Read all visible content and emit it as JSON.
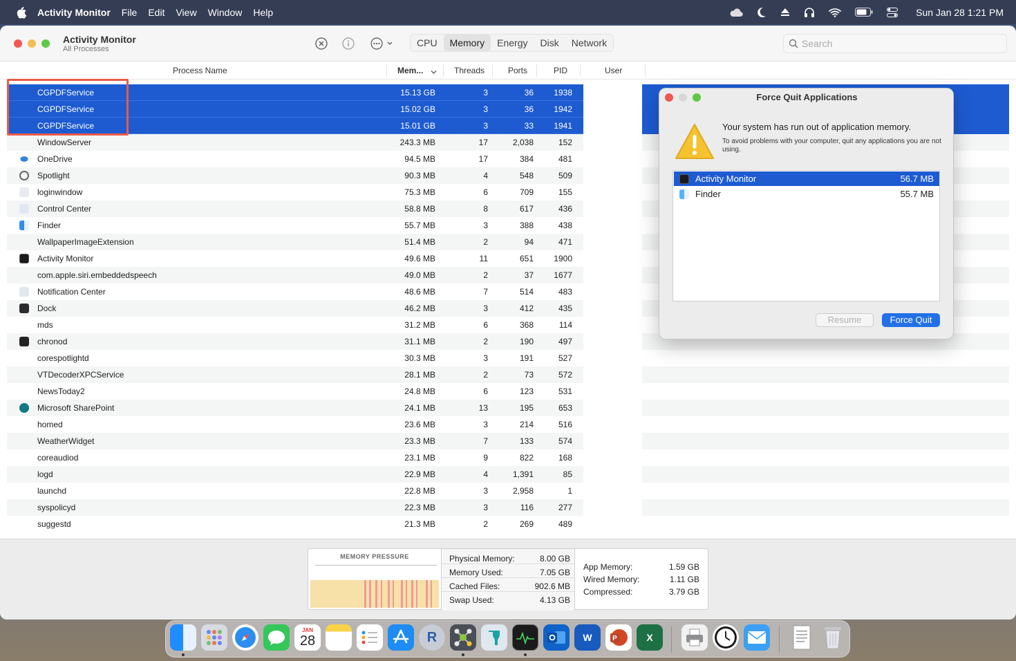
{
  "menubar": {
    "app_name": "Activity Monitor",
    "items": [
      "File",
      "Edit",
      "View",
      "Window",
      "Help"
    ],
    "clock": "Sun Jan 28  1:21 PM",
    "status_icons": [
      "icloud-icon",
      "moon-icon",
      "eject-icon",
      "headphones-icon",
      "wifi-icon",
      "battery-icon",
      "control-center-icon"
    ]
  },
  "window": {
    "title": "Activity Monitor",
    "subtitle": "All Processes",
    "tabs": [
      "CPU",
      "Memory",
      "Energy",
      "Disk",
      "Network"
    ],
    "active_tab": "Memory",
    "search_placeholder": "Search"
  },
  "table": {
    "columns": {
      "name": "Process Name",
      "mem": "Mem...",
      "threads": "Threads",
      "ports": "Ports",
      "pid": "PID",
      "user": "User"
    },
    "rows": [
      {
        "name": "CGPDFService",
        "mem": "15.13 GB",
        "threads": "3",
        "ports": "36",
        "pid": "1938",
        "icon": "none",
        "selected": true
      },
      {
        "name": "CGPDFService",
        "mem": "15.02 GB",
        "threads": "3",
        "ports": "36",
        "pid": "1942",
        "icon": "none",
        "selected": true
      },
      {
        "name": "CGPDFService",
        "mem": "15.01 GB",
        "threads": "3",
        "ports": "33",
        "pid": "1941",
        "icon": "none",
        "selected": true
      },
      {
        "name": "WindowServer",
        "mem": "243.3 MB",
        "threads": "17",
        "ports": "2,038",
        "pid": "152",
        "icon": "none"
      },
      {
        "name": "OneDrive",
        "mem": "94.5 MB",
        "threads": "17",
        "ports": "384",
        "pid": "481",
        "icon": "onedrive-icon"
      },
      {
        "name": "Spotlight",
        "mem": "90.3 MB",
        "threads": "4",
        "ports": "548",
        "pid": "509",
        "icon": "spotlight-icon"
      },
      {
        "name": "loginwindow",
        "mem": "75.3 MB",
        "threads": "6",
        "ports": "709",
        "pid": "155",
        "icon": "loginwindow-icon"
      },
      {
        "name": "Control Center",
        "mem": "58.8 MB",
        "threads": "8",
        "ports": "617",
        "pid": "436",
        "icon": "control-center-icon"
      },
      {
        "name": "Finder",
        "mem": "55.7 MB",
        "threads": "3",
        "ports": "388",
        "pid": "438",
        "icon": "finder-icon"
      },
      {
        "name": "WallpaperImageExtension",
        "mem": "51.4 MB",
        "threads": "2",
        "ports": "94",
        "pid": "471",
        "icon": "none"
      },
      {
        "name": "Activity Monitor",
        "mem": "49.6 MB",
        "threads": "11",
        "ports": "651",
        "pid": "1900",
        "icon": "activity-monitor-icon"
      },
      {
        "name": "com.apple.siri.embeddedspeech",
        "mem": "49.0 MB",
        "threads": "2",
        "ports": "37",
        "pid": "1677",
        "icon": "none"
      },
      {
        "name": "Notification Center",
        "mem": "48.6 MB",
        "threads": "7",
        "ports": "514",
        "pid": "483",
        "icon": "notification-center-icon"
      },
      {
        "name": "Dock",
        "mem": "46.2 MB",
        "threads": "3",
        "ports": "412",
        "pid": "435",
        "icon": "dock-icon"
      },
      {
        "name": "mds",
        "mem": "31.2 MB",
        "threads": "6",
        "ports": "368",
        "pid": "114",
        "icon": "none"
      },
      {
        "name": "chronod",
        "mem": "31.1 MB",
        "threads": "2",
        "ports": "190",
        "pid": "497",
        "icon": "chronod-icon"
      },
      {
        "name": "corespotlightd",
        "mem": "30.3 MB",
        "threads": "3",
        "ports": "191",
        "pid": "527",
        "icon": "none"
      },
      {
        "name": "VTDecoderXPCService",
        "mem": "28.1 MB",
        "threads": "2",
        "ports": "73",
        "pid": "572",
        "icon": "none"
      },
      {
        "name": "NewsToday2",
        "mem": "24.8 MB",
        "threads": "6",
        "ports": "123",
        "pid": "531",
        "icon": "none"
      },
      {
        "name": "Microsoft SharePoint",
        "mem": "24.1 MB",
        "threads": "13",
        "ports": "195",
        "pid": "653",
        "icon": "sharepoint-icon"
      },
      {
        "name": "homed",
        "mem": "23.6 MB",
        "threads": "3",
        "ports": "214",
        "pid": "516",
        "icon": "none"
      },
      {
        "name": "WeatherWidget",
        "mem": "23.3 MB",
        "threads": "7",
        "ports": "133",
        "pid": "574",
        "icon": "none"
      },
      {
        "name": "coreaudiod",
        "mem": "23.1 MB",
        "threads": "9",
        "ports": "822",
        "pid": "168",
        "icon": "none"
      },
      {
        "name": "logd",
        "mem": "22.9 MB",
        "threads": "4",
        "ports": "1,391",
        "pid": "85",
        "icon": "none"
      },
      {
        "name": "launchd",
        "mem": "22.8 MB",
        "threads": "3",
        "ports": "2,958",
        "pid": "1",
        "icon": "none"
      },
      {
        "name": "syspolicyd",
        "mem": "22.3 MB",
        "threads": "3",
        "ports": "116",
        "pid": "277",
        "icon": "none"
      },
      {
        "name": "suggestd",
        "mem": "21.3 MB",
        "threads": "2",
        "ports": "269",
        "pid": "489",
        "icon": "none"
      }
    ]
  },
  "memory_pressure": {
    "title": "MEMORY PRESSURE",
    "colors": {
      "normal": "#f7e1a8",
      "critical": "#ef9a9a"
    },
    "stats_mid": [
      {
        "label": "Physical Memory:",
        "value": "8.00 GB"
      },
      {
        "label": "Memory Used:",
        "value": "7.05 GB"
      },
      {
        "label": "Cached Files:",
        "value": "902.6 MB"
      },
      {
        "label": "Swap Used:",
        "value": "4.13 GB"
      }
    ],
    "stats_right": [
      {
        "label": "App Memory:",
        "value": "1.59 GB"
      },
      {
        "label": "Wired Memory:",
        "value": "1.11 GB"
      },
      {
        "label": "Compressed:",
        "value": "3.79 GB"
      }
    ]
  },
  "dialog": {
    "title": "Force Quit Applications",
    "message": "Your system has run out of application memory.",
    "submessage": "To avoid problems with your computer, quit any applications you are not using.",
    "apps": [
      {
        "name": "Activity Monitor",
        "mem": "56.7 MB",
        "icon": "activity-monitor-icon",
        "selected": true
      },
      {
        "name": "Finder",
        "mem": "55.7 MB",
        "icon": "finder-icon",
        "selected": false
      }
    ],
    "resume_label": "Resume",
    "force_quit_label": "Force Quit"
  },
  "dock": {
    "calendar_month": "JAN",
    "calendar_day": "28",
    "r_label": "R",
    "items": [
      "finder-icon",
      "launchpad-icon",
      "safari-icon",
      "messages-icon",
      "calendar-icon",
      "notes-icon",
      "reminders-icon",
      "app-store-icon",
      "r-icon",
      "molecule-app-icon",
      "stretchly-icon",
      "activity-monitor-icon",
      "outlook-icon",
      "word-icon",
      "powerpoint-icon",
      "excel-icon",
      "printer-icon",
      "clock-icon",
      "mail-icon",
      "document-icon",
      "trash-icon"
    ]
  },
  "colors": {
    "accent": "#1e5bd1",
    "highlight_box": "#ea5b4a"
  }
}
